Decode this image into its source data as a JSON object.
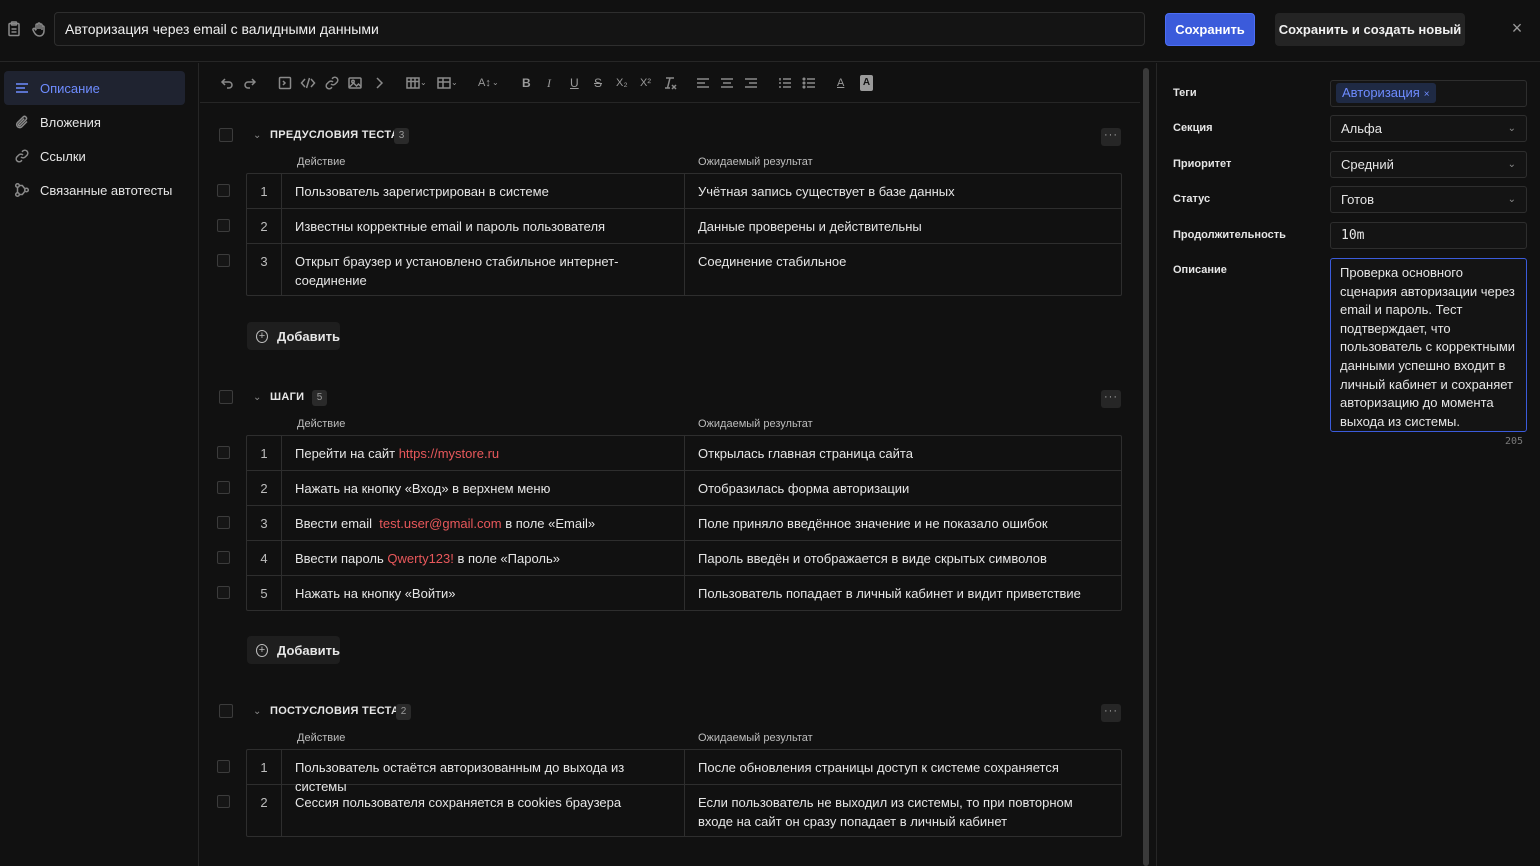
{
  "header": {
    "title_value": "Авторизация через email с валидными данными",
    "save_label": "Сохранить",
    "save_new_label": "Сохранить и создать новый",
    "close_label": "×"
  },
  "sidebar": {
    "items": [
      {
        "label": "Описание",
        "icon": "list-icon",
        "active": true
      },
      {
        "label": "Вложения",
        "icon": "paperclip-icon"
      },
      {
        "label": "Ссылки",
        "icon": "link-icon"
      },
      {
        "label": "Связанные автотесты",
        "icon": "tree-icon"
      }
    ]
  },
  "toolbar": {
    "tools": [
      "undo",
      "redo",
      "code-block",
      "inline-code",
      "link",
      "image",
      "chevron",
      "table",
      "table-edit",
      "text-size",
      "bold",
      "italic",
      "underline",
      "strike",
      "subscript",
      "superscript",
      "clear-format",
      "align-left",
      "align-center",
      "align-right",
      "ordered-list",
      "bullet-list",
      "text-color",
      "highlight"
    ],
    "bold": "B",
    "italic": "I",
    "underline": "U",
    "strike": "S",
    "subscript": "X₂",
    "superscript": "X²"
  },
  "columns": {
    "action": "Действие",
    "result": "Ожидаемый результат"
  },
  "add_label": "Добавить",
  "sections": [
    {
      "title": "ПРЕДУСЛОВИЯ ТЕСТА",
      "count": "3",
      "rows": [
        {
          "n": "1",
          "action": "Пользователь зарегистрирован в системе",
          "result": "Учётная запись существует в базе данных"
        },
        {
          "n": "2",
          "action": "Известны корректные email и пароль пользователя",
          "result": "Данные проверены и действительны"
        },
        {
          "n": "3",
          "action": "Открыт браузер и установлено стабильное интернет-соединение",
          "result": "Соединение стабильное"
        }
      ]
    },
    {
      "title": "ШАГИ",
      "count": "5",
      "rows": [
        {
          "n": "1",
          "action_pre": "Перейти на сайт ",
          "action_link": "https://mystore.ru",
          "action_post": "",
          "result": "Открылась главная страница сайта"
        },
        {
          "n": "2",
          "action": "Нажать на кнопку «Вход» в верхнем меню",
          "result": "Отобразилась форма авторизации"
        },
        {
          "n": "3",
          "action_pre": "Ввести email  ",
          "action_link": "test.user@gmail.com",
          "action_post": " в поле «Email»",
          "result": "Поле приняло введённое значение и не показало ошибок"
        },
        {
          "n": "4",
          "action_pre": "Ввести пароль ",
          "action_link": "Qwerty123!",
          "action_post": " в поле «Пароль»",
          "result": "Пароль введён и отображается в виде скрытых символов"
        },
        {
          "n": "5",
          "action": "Нажать на кнопку «Войти»",
          "result": "Пользователь попадает в личный кабинет и видит приветствие"
        }
      ]
    },
    {
      "title": "ПОСТУСЛОВИЯ ТЕСТА",
      "count": "2",
      "rows": [
        {
          "n": "1",
          "action": "Пользователь остаётся авторизованным до выхода из системы",
          "result": "После обновления страницы доступ к системе сохраняется"
        },
        {
          "n": "2",
          "action": "Сессия пользователя сохраняется в cookies браузера",
          "result": "Если пользователь не выходил из системы, то при повторном входе на сайт он сразу попадает в личный кабинет"
        }
      ]
    }
  ],
  "properties": {
    "tags_label": "Теги",
    "tag_value": "Авторизация",
    "tag_remove": "×",
    "section_label": "Секция",
    "section_value": "Альфа",
    "priority_label": "Приоритет",
    "priority_value": "Средний",
    "status_label": "Статус",
    "status_value": "Готов",
    "duration_label": "Продолжительность",
    "duration_value": "10m",
    "description_label": "Описание",
    "description_value": "Проверка основного сценария авторизации через email и пароль. Тест подтверждает, что пользователь с корректными данными успешно входит в личный кабинет и сохраняет авторизацию до момента выхода из системы.",
    "char_count": "205"
  },
  "colors": {
    "accent": "#3b5bdb",
    "link": "#e8585b",
    "background": "#111111"
  }
}
